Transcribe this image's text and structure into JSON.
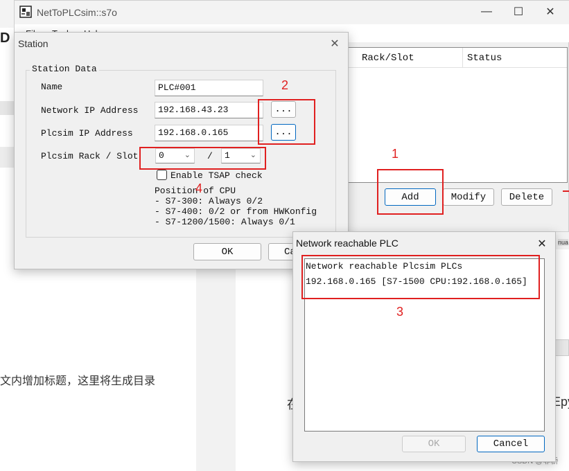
{
  "background": {
    "truncated_heading": "D",
    "cn_text": "文内增加标题，这里将生成目录",
    "right_text_1": "在",
    "right_text_2": "Epy",
    "side_tag": "nua",
    "watermark": "CSDN @非骄"
  },
  "main_window": {
    "title": "NetToPLCsim::s7o",
    "menu": [
      "File",
      "Tools",
      "Help"
    ],
    "controls": {
      "minimize": "—",
      "maximize": "☐",
      "close": "✕"
    },
    "list_columns": [
      "Rack/Slot",
      "Status"
    ],
    "buttons": {
      "add": "Add",
      "modify": "Modify",
      "delete": "Delete"
    }
  },
  "station_dialog": {
    "title": "Station",
    "close": "✕",
    "group_title": "Station Data",
    "name_label": "Name",
    "name_value": "PLC#001",
    "network_ip_label": "Network IP Address",
    "network_ip_value": "192.168.43.23",
    "plcsim_ip_label": "Plcsim IP Address",
    "plcsim_ip_value": "192.168.0.165",
    "browse_label": "...",
    "rack_slot_label": "Plcsim Rack / Slot",
    "rack_value": "0",
    "slot_separator": "/",
    "slot_value": "1",
    "tsap_label": "Enable TSAP check",
    "cpu_info": [
      "Position of CPU",
      "- S7-300: Always 0/2",
      "- S7-400: 0/2 or from HWKonfig",
      "- S7-1200/1500: Always 0/1"
    ],
    "ok_label": "OK",
    "cancel_label": "Ca"
  },
  "network_dialog": {
    "title": "Network reachable PLC",
    "close": "✕",
    "list_header": "Network reachable Plcsim PLCs",
    "items": [
      "192.168.0.165 [S7-1500 CPU:192.168.0.165]"
    ],
    "ok_label": "OK",
    "cancel_label": "Cancel"
  },
  "annotations": [
    "1",
    "2",
    "3",
    "4"
  ],
  "colors": {
    "annotation_red": "#e02020",
    "focus_blue": "#0067c0",
    "dialog_bg": "#f0f0f0"
  }
}
